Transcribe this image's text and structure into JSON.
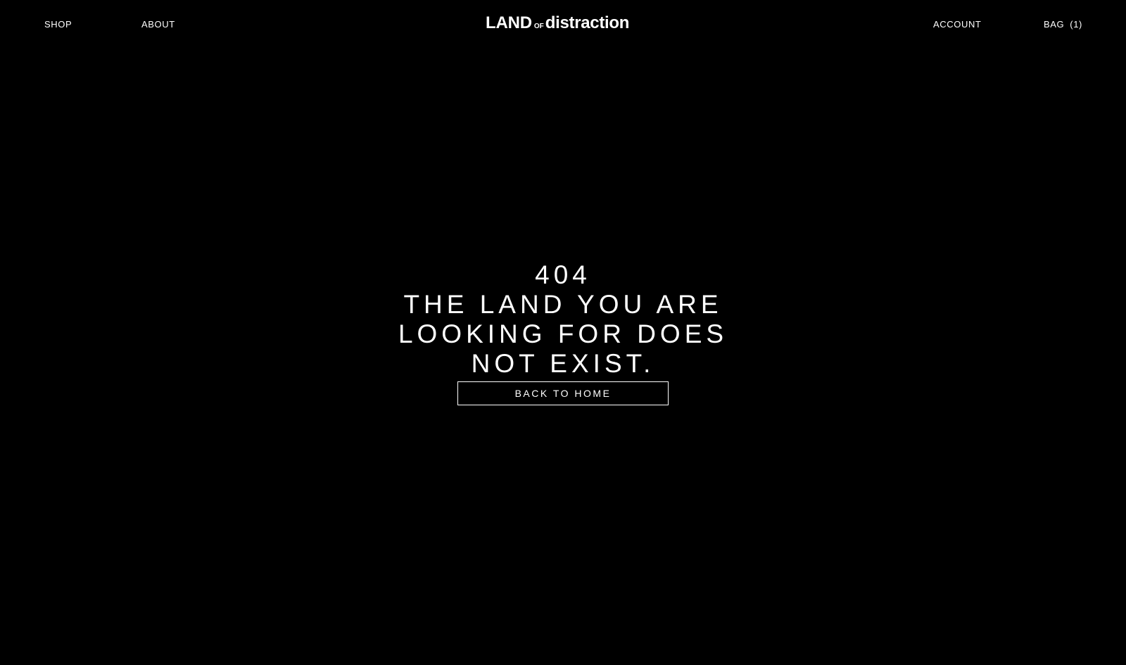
{
  "header": {
    "nav_left": {
      "shop": "SHOP",
      "about": "ABOUT"
    },
    "logo": {
      "part1": "LAND",
      "part2": "OF",
      "part3": "distraction"
    },
    "nav_right": {
      "account": "ACCOUNT",
      "bag_label": "BAG",
      "bag_count": "(1)"
    }
  },
  "main": {
    "error_code": "404",
    "error_message": "THE LAND YOU ARE LOOKING FOR DOES NOT EXIST.",
    "back_button": "BACK TO HOME"
  },
  "colors": {
    "background": "#000000",
    "text": "#ffffff"
  }
}
